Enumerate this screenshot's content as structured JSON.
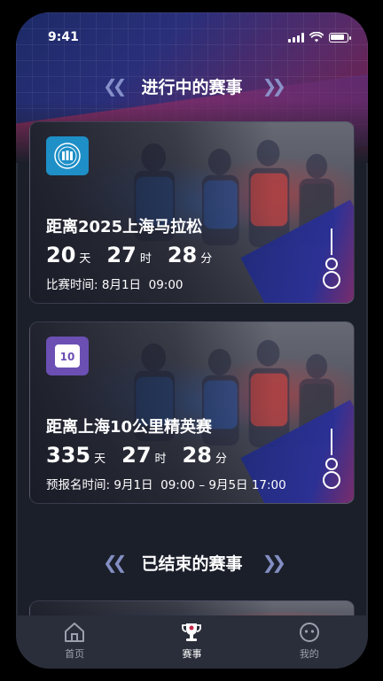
{
  "status_bar": {
    "time": "9:41"
  },
  "sections": {
    "ongoing_title": "进行中的赛事",
    "ended_title": "已结束的赛事"
  },
  "cards": [
    {
      "title": "距离2025上海马拉松",
      "logo_icon": "shanghai-marathon-logo-icon",
      "logo_color": "#1e8fc7",
      "days": "20",
      "days_unit": "天",
      "hours": "27",
      "hours_unit": "时",
      "minutes": "28",
      "minutes_unit": "分",
      "time_label": "比赛时间:",
      "time_value": "8月1日  09:00"
    },
    {
      "title": "距离上海10公里精英赛",
      "logo_icon": "10k-race-logo-icon",
      "logo_color": "#6b4fb3",
      "days": "335",
      "days_unit": "天",
      "hours": "27",
      "hours_unit": "时",
      "minutes": "28",
      "minutes_unit": "分",
      "time_label": "预报名时间:",
      "time_value": "9月1日  09:00 – 9月5日 17:00"
    }
  ],
  "tabbar": {
    "items": [
      {
        "label": "首页",
        "icon": "home-icon",
        "active": false
      },
      {
        "label": "赛事",
        "icon": "trophy-icon",
        "active": true
      },
      {
        "label": "我的",
        "icon": "profile-face-icon",
        "active": false
      }
    ]
  },
  "colors": {
    "background": "#1b1f2a",
    "tabbar": "#2a2e3a",
    "accent_red": "#c4284a",
    "accent_blue": "#2a2f9a"
  }
}
